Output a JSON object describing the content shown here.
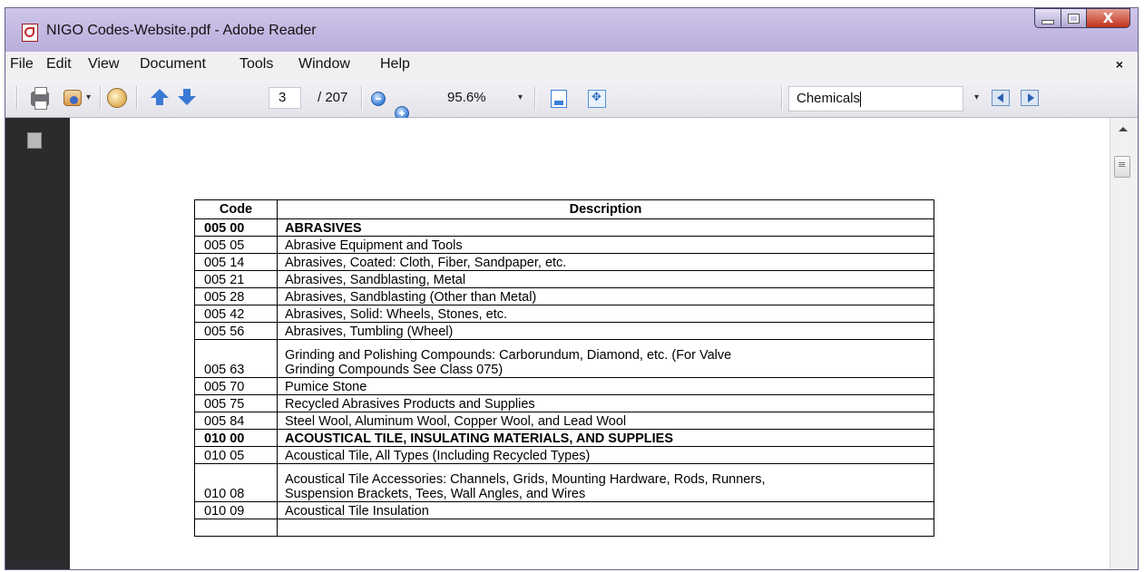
{
  "window": {
    "title": "NIGO Codes-Website.pdf - Adobe Reader",
    "close_glyph": "X"
  },
  "menu": {
    "items": [
      "File",
      "Edit",
      "View",
      "Document",
      "Tools",
      "Window",
      "Help"
    ],
    "close_glyph": "×"
  },
  "toolbar": {
    "page_current": "3",
    "page_total": "/ 207",
    "zoom": "95.6%",
    "search_value": "Chemicals"
  },
  "icons": {
    "app": "adobe-reader-icon",
    "print": "printer-icon",
    "email": "email-icon",
    "hand": "hand-tool-icon",
    "prev_page": "arrow-up-icon",
    "next_page": "arrow-down-icon",
    "zoom_out": "zoom-out-icon",
    "zoom_in": "zoom-in-icon",
    "fit_page": "fit-page-icon",
    "fit_width": "fit-width-icon",
    "find_prev": "find-previous-icon",
    "find_next": "find-next-icon",
    "pages_panel": "pages-panel-icon"
  },
  "document": {
    "headers": {
      "code": "Code",
      "description": "Description"
    },
    "rows": [
      {
        "code": "005 00",
        "description": "ABRASIVES",
        "bold": true
      },
      {
        "code": "005 05",
        "description": "Abrasive Equipment and Tools"
      },
      {
        "code": "005 14",
        "description": "Abrasives, Coated: Cloth, Fiber, Sandpaper, etc."
      },
      {
        "code": "005 21",
        "description": "Abrasives, Sandblasting, Metal"
      },
      {
        "code": "005 28",
        "description": "Abrasives, Sandblasting (Other than Metal)"
      },
      {
        "code": "005 42",
        "description": "Abrasives, Solid: Wheels, Stones, etc."
      },
      {
        "code": "005 56",
        "description": "Abrasives, Tumbling (Wheel)"
      },
      {
        "code": "005 63",
        "description": "Grinding and Polishing Compounds: Carborundum, Diamond, etc. (For Valve",
        "description2": "Grinding Compounds See Class 075)"
      },
      {
        "code": "005 70",
        "description": "Pumice Stone"
      },
      {
        "code": "005 75",
        "description": "Recycled Abrasives Products and Supplies"
      },
      {
        "code": "005 84",
        "description": "Steel Wool, Aluminum Wool, Copper Wool, and Lead Wool"
      },
      {
        "code": "010 00",
        "description": "ACOUSTICAL TILE, INSULATING MATERIALS, AND SUPPLIES",
        "bold": true
      },
      {
        "code": "010 05",
        "description": "Acoustical Tile, All Types (Including Recycled Types)"
      },
      {
        "code": "010 08",
        "description": "Acoustical Tile Accessories: Channels, Grids, Mounting Hardware, Rods, Runners,",
        "description2": "Suspension Brackets, Tees, Wall Angles, and Wires"
      },
      {
        "code": "010 09",
        "description": "Acoustical Tile Insulation"
      }
    ]
  }
}
